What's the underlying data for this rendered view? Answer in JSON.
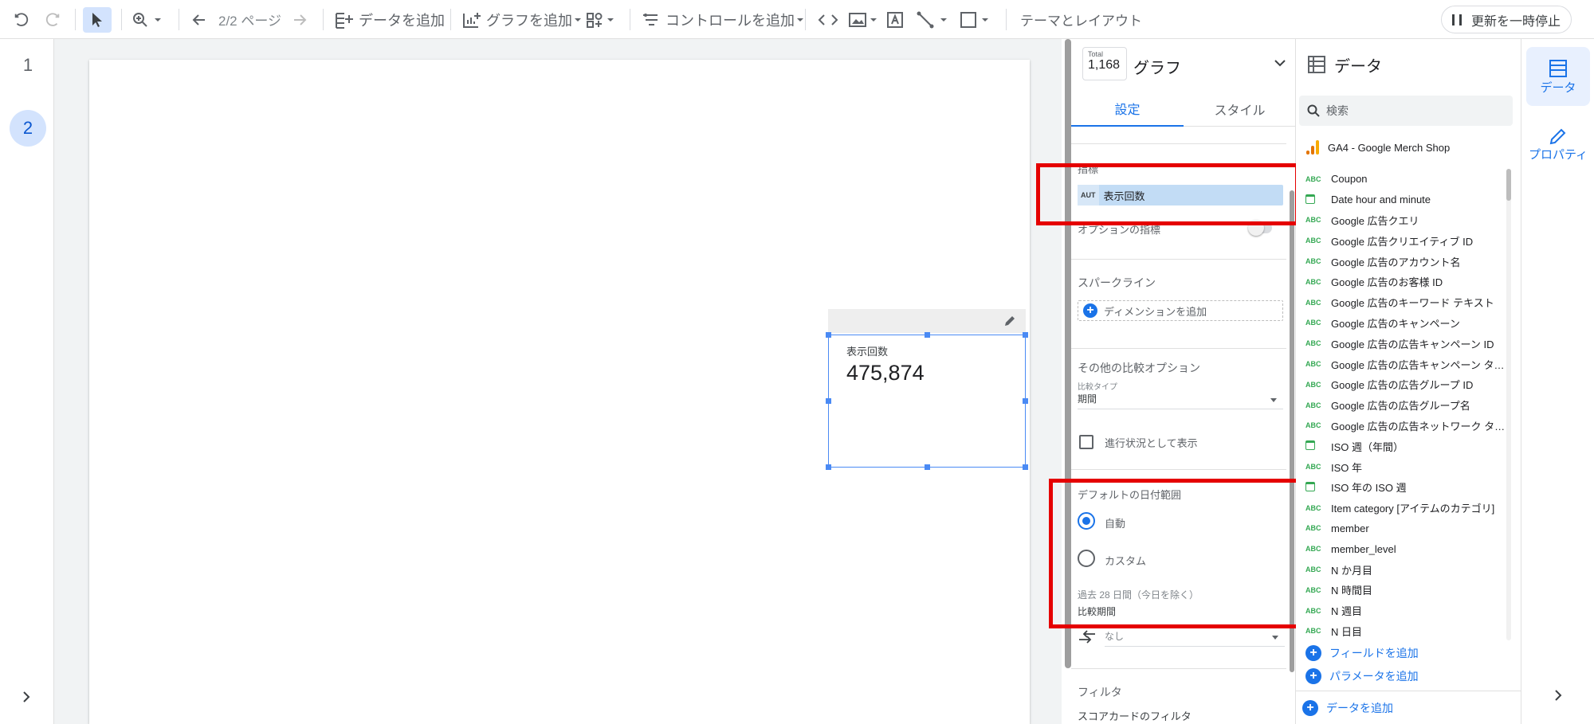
{
  "toolbar": {
    "page_indicator": "2/2 ページ",
    "add_data": "データを追加",
    "add_chart": "グラフを追加",
    "add_control": "コントロールを追加",
    "theme_layout": "テーマとレイアウト",
    "pause_update": "更新を一時停止"
  },
  "pages": [
    "1",
    "2"
  ],
  "scorecard": {
    "label": "表示回数",
    "value": "475,874"
  },
  "props": {
    "total_label": "Total",
    "total_value": "1,168",
    "title": "グラフ",
    "tabs": [
      "設定",
      "スタイル"
    ],
    "metric_section": "指標",
    "metric_chip_type": "AUT",
    "metric_chip_label": "表示回数",
    "optional_metric": "オプションの指標",
    "sparkline": "スパークライン",
    "add_dimension": "ディメンションを追加",
    "comparison_options": "その他の比較オプション",
    "comparison_type_label": "比較タイプ",
    "comparison_type_value": "期間",
    "progress_display": "進行状況として表示",
    "default_date_range": "デフォルトの日付範囲",
    "radio_auto": "自動",
    "radio_custom": "カスタム",
    "date_range_note": "過去 28 日間（今日を除く）",
    "comparison_period": "比較期間",
    "comparison_period_value": "なし",
    "filter": "フィルタ",
    "scorecard_filter": "スコアカードのフィルタ"
  },
  "data_panel": {
    "title": "データ",
    "search_placeholder": "検索",
    "source_name": "GA4 - Google Merch Shop",
    "fields": [
      {
        "type": "ABC",
        "name": "Coupon"
      },
      {
        "type": "date",
        "name": "Date hour and minute"
      },
      {
        "type": "ABC",
        "name": "Google 広告クエリ"
      },
      {
        "type": "ABC",
        "name": "Google 広告クリエイティブ ID"
      },
      {
        "type": "ABC",
        "name": "Google 広告のアカウント名"
      },
      {
        "type": "ABC",
        "name": "Google 広告のお客様 ID"
      },
      {
        "type": "ABC",
        "name": "Google 広告のキーワード テキスト"
      },
      {
        "type": "ABC",
        "name": "Google 広告のキャンペーン"
      },
      {
        "type": "ABC",
        "name": "Google 広告の広告キャンペーン ID"
      },
      {
        "type": "ABC",
        "name": "Google 広告の広告キャンペーン タ…"
      },
      {
        "type": "ABC",
        "name": "Google 広告の広告グループ ID"
      },
      {
        "type": "ABC",
        "name": "Google 広告の広告グループ名"
      },
      {
        "type": "ABC",
        "name": "Google 広告の広告ネットワーク タ…"
      },
      {
        "type": "date",
        "name": "ISO 週（年間）"
      },
      {
        "type": "ABC",
        "name": "ISO 年"
      },
      {
        "type": "date",
        "name": "ISO 年の ISO 週"
      },
      {
        "type": "ABC",
        "name": "Item category [アイテムのカテゴリ]"
      },
      {
        "type": "ABC",
        "name": "member"
      },
      {
        "type": "ABC",
        "name": "member_level"
      },
      {
        "type": "ABC",
        "name": "N か月目"
      },
      {
        "type": "ABC",
        "name": "N 時間目"
      },
      {
        "type": "ABC",
        "name": "N 週目"
      },
      {
        "type": "ABC",
        "name": "N 日目"
      }
    ],
    "add_field": "フィールドを追加",
    "add_parameter": "パラメータを追加",
    "add_data": "データを追加"
  },
  "side_panel": {
    "data": "データ",
    "properties": "プロパティ"
  },
  "colors": {
    "accent": "#1a73e8",
    "highlight": "#e50000",
    "selected_chip": "#c2dcf5"
  }
}
